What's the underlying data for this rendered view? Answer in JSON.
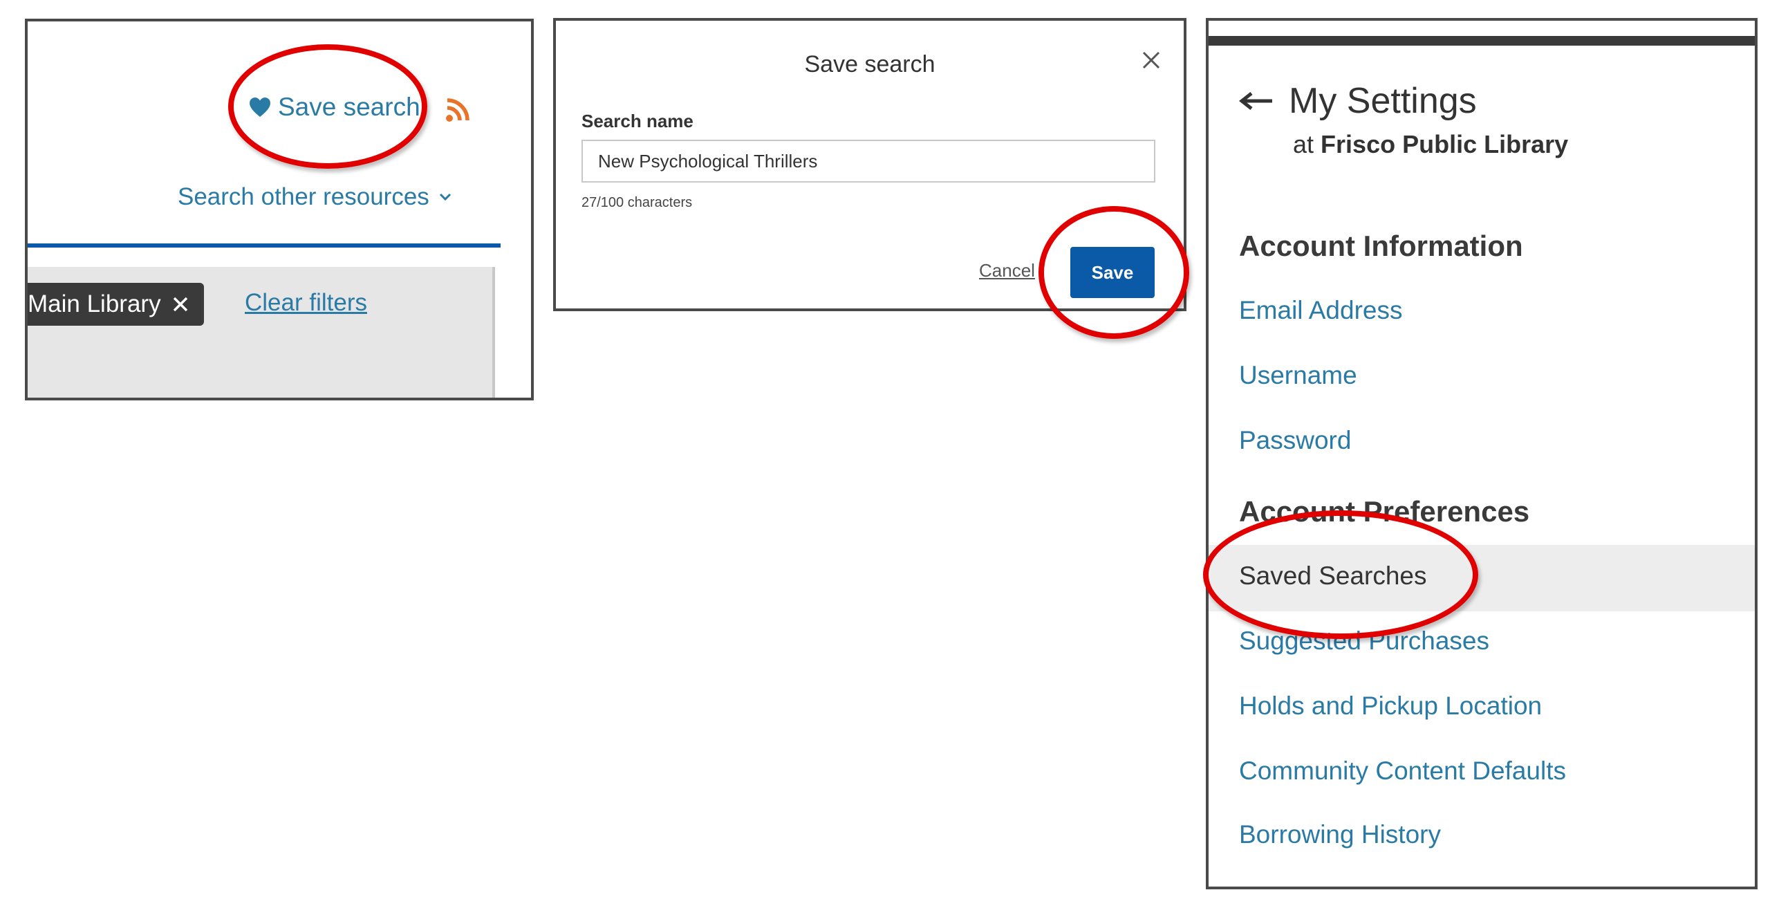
{
  "panel_results": {
    "save_search_label": "Save search",
    "search_other_label": "Search other resources",
    "filter_chip_label": "Main Library",
    "clear_filters_label": "Clear filters",
    "icons": {
      "heart": "heart-icon",
      "rss": "rss-icon",
      "chevron": "chevron-down-icon",
      "close": "close-icon"
    }
  },
  "panel_dialog": {
    "title": "Save search",
    "field_label": "Search name",
    "field_value": "New Psychological Thrillers",
    "char_count": "27/100 characters",
    "cancel_label": "Cancel",
    "save_label": "Save",
    "icons": {
      "close": "close-icon"
    }
  },
  "panel_settings": {
    "back_title": "My Settings",
    "at_prefix": "at",
    "library_name": "Frisco Public Library",
    "section_account_info": "Account Information",
    "account_items": [
      "Email Address",
      "Username",
      "Password"
    ],
    "section_preferences": "Account Preferences",
    "preference_items": [
      "Saved Searches",
      "Suggested Purchases",
      "Holds and Pickup Location",
      "Community Content Defaults",
      "Borrowing History"
    ],
    "selected_item": "Saved Searches",
    "icons": {
      "back": "arrow-left-icon"
    }
  },
  "colors": {
    "link": "#2a7aa6",
    "primary_button": "#0a5aa8",
    "annotation_red": "#e00000",
    "chip_bg": "#3a3a3a",
    "rss": "#e8742a"
  }
}
